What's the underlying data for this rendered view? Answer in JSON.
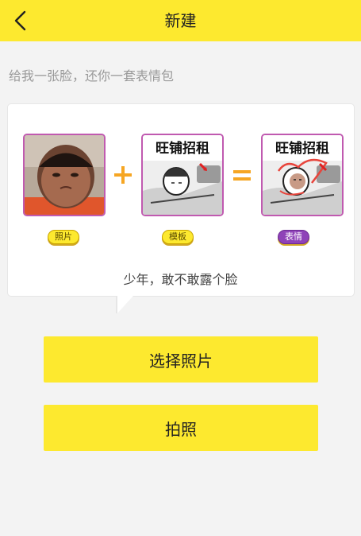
{
  "nav": {
    "title": "新建",
    "back_icon": "chevron-left-icon"
  },
  "intro": {
    "subtitle": "给我一张脸，还你一套表情包"
  },
  "example": {
    "photo_label": "照片",
    "template_label": "模板",
    "result_label": "表情",
    "template_text": "旺铺招租",
    "caption": "少年，敢不敢露个脸",
    "plus_icon": "plus-icon",
    "equals_icon": "equals-icon"
  },
  "actions": {
    "choose_photo": "选择照片",
    "take_photo": "拍照"
  },
  "colors": {
    "brand_yellow": "#fde92f",
    "accent_orange": "#f6a623",
    "tag_purple": "#8f42b8",
    "thumb_border": "#c05ab0"
  }
}
